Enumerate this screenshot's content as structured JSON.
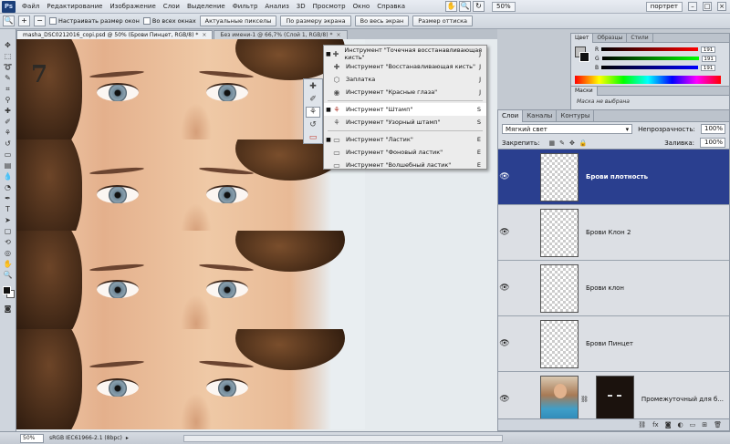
{
  "menubar": {
    "logo": "Ps",
    "items": [
      "Файл",
      "Редактирование",
      "Изображение",
      "Слои",
      "Выделение",
      "Фильтр",
      "Анализ",
      "3D",
      "Просмотр",
      "Окно",
      "Справка"
    ],
    "zoom": "50%",
    "workspace": "портрет"
  },
  "options": {
    "resize_windows": "Настраивать размер окон",
    "all_windows": "Во всех окнах",
    "actual_pixels": "Актуальные пикселы",
    "fit_screen": "По размеру экрана",
    "fill_screen": "Во весь экран",
    "print_size": "Размер оттиска"
  },
  "doc_tabs": [
    {
      "label": "masha_DSC0212016_copi.psd @ 50% (Брови Пинцет, RGB/8) *"
    },
    {
      "label": "Без имени-1 @ 66,7% (Слой 1, RGB/8) *"
    }
  ],
  "canvas": {
    "strip_label": "7"
  },
  "flyout": {
    "items": [
      {
        "label": "Инструмент \"Точечная восстанавливающая кисть\"",
        "key": "J",
        "active": true
      },
      {
        "label": "Инструмент \"Восстанавливающая кисть\"",
        "key": "J",
        "active": false
      },
      {
        "label": "Заплатка",
        "key": "J",
        "active": false
      },
      {
        "label": "Инструмент \"Красные глаза\"",
        "key": "J",
        "active": false
      },
      {
        "label": "Инструмент \"Штамп\"",
        "key": "S",
        "active": true
      },
      {
        "label": "Инструмент \"Узорный штамп\"",
        "key": "S",
        "active": false
      },
      {
        "label": "Инструмент \"Ластик\"",
        "key": "E",
        "active": true
      },
      {
        "label": "Инструмент \"Фоновый ластик\"",
        "key": "E",
        "active": false
      },
      {
        "label": "Инструмент \"Волшебный ластик\"",
        "key": "E",
        "active": false
      }
    ]
  },
  "color_panel": {
    "tabs": [
      "Цвет",
      "Образцы",
      "Стили"
    ],
    "r_label": "R",
    "r_value": "191",
    "g_label": "G",
    "g_value": "191",
    "b_label": "B",
    "b_value": "191"
  },
  "mask_panel": {
    "tab": "Маски",
    "text": "Маска не выбрана"
  },
  "layers_panel": {
    "tabs": [
      "Слои",
      "Каналы",
      "Контуры"
    ],
    "blend_mode": "Мягкий свет",
    "opacity_label": "Непрозрачность:",
    "opacity_value": "100%",
    "lock_label": "Закрепить:",
    "fill_label": "Заливка:",
    "fill_value": "100%",
    "layers": [
      {
        "name": "Брови плотность"
      },
      {
        "name": "Брови Клон 2"
      },
      {
        "name": "Брови клон"
      },
      {
        "name": "Брови Пинцет"
      },
      {
        "name": "Промежуточный для б..."
      }
    ]
  },
  "status": {
    "zoom": "50%",
    "profile": "sRGB IEC61966-2.1 (8bpc)"
  }
}
